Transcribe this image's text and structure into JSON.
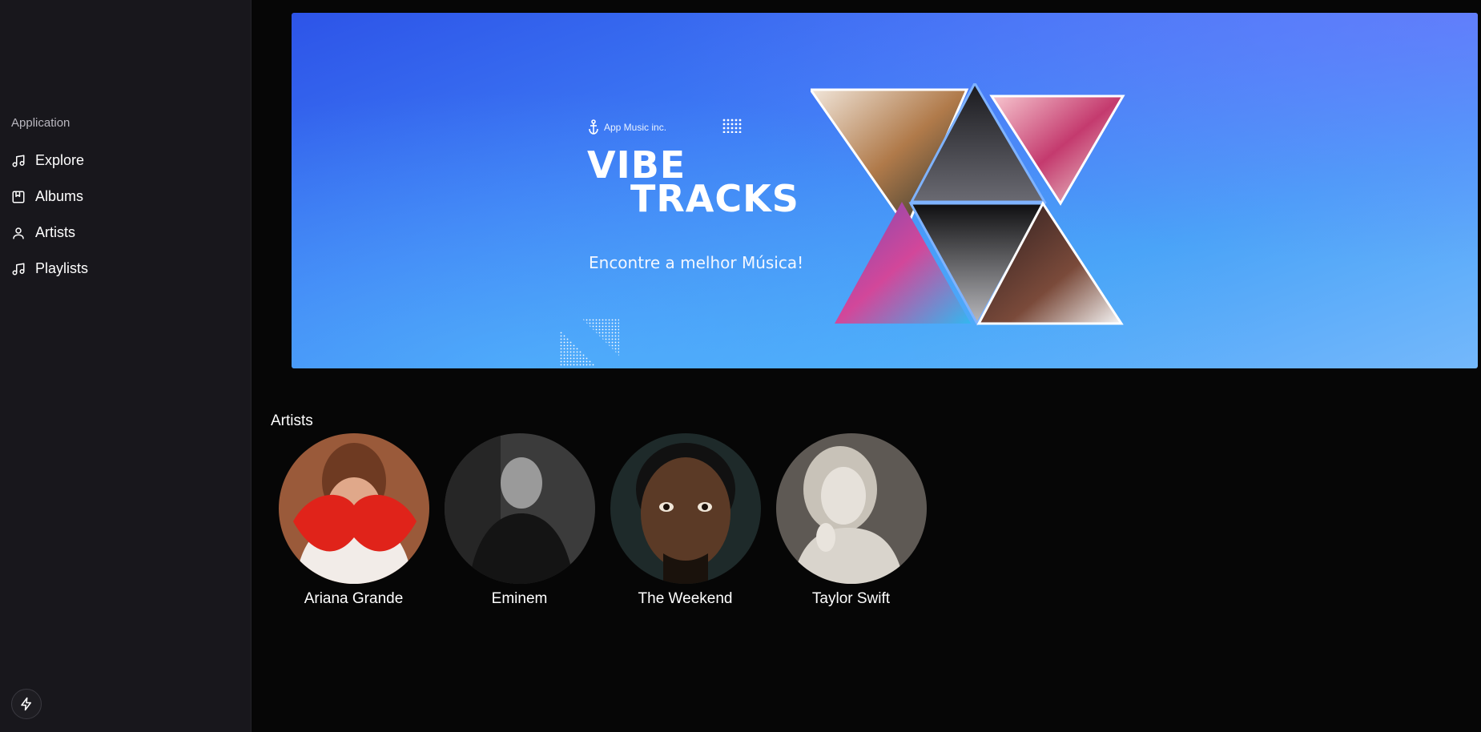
{
  "sidebar": {
    "logo_icon": "sound-wave-logo",
    "section_label": "Application",
    "items": [
      {
        "label": "Explore",
        "icon": "music-note-icon"
      },
      {
        "label": "Albums",
        "icon": "bookmark-album-icon"
      },
      {
        "label": "Artists",
        "icon": "user-icon"
      },
      {
        "label": "Playlists",
        "icon": "music-note-icon"
      }
    ],
    "footer_icon": "lightning-icon"
  },
  "banner": {
    "brand": "App Music inc.",
    "title_line1": "VIBE",
    "title_line2": "TRACKS",
    "tagline": "Encontre a melhor Música!",
    "colors": {
      "gradient_start": "#2d54e8",
      "gradient_end": "#74b8fb"
    }
  },
  "artists": {
    "heading": "Artists",
    "items": [
      {
        "name": "Ariana Grande",
        "color": "#c8231a"
      },
      {
        "name": "Eminem",
        "color": "#3a3a3a"
      },
      {
        "name": "The Weekend",
        "color": "#4a3424"
      },
      {
        "name": "Taylor Swift",
        "color": "#6b6660"
      }
    ]
  }
}
